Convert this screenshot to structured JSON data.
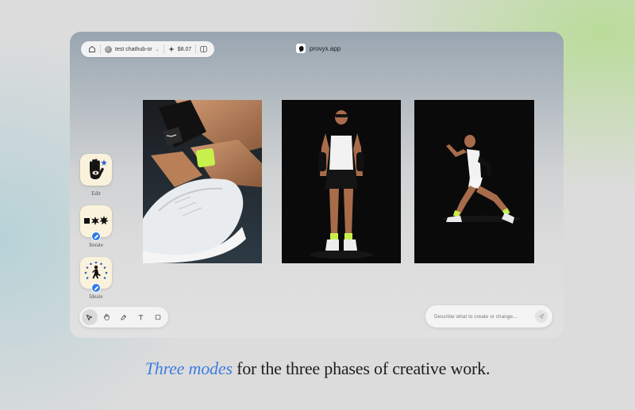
{
  "topbar": {
    "home_icon": "home-icon",
    "workspace": "test chathub-or",
    "credits": "$8.07",
    "credits_icon": "sparkle-icon",
    "panel_icon": "panel-icon"
  },
  "brand": {
    "name": "provyx.app",
    "logo_icon": "head-silhouette-icon"
  },
  "modes": [
    {
      "label": "Edit",
      "icon": "hand-eye-icon"
    },
    {
      "label": "Iterate",
      "icon": "shapes-icon"
    },
    {
      "label": "Ideate",
      "icon": "walking-person-stars-icon"
    }
  ],
  "tools": [
    {
      "name": "pointer",
      "icon": "cursor-icon",
      "active": true
    },
    {
      "name": "hand",
      "icon": "hand-icon",
      "active": false
    },
    {
      "name": "pen",
      "icon": "pen-icon",
      "active": false
    },
    {
      "name": "text",
      "icon": "text-icon",
      "active": false
    },
    {
      "name": "rectangle",
      "icon": "square-icon",
      "active": false
    }
  ],
  "prompt": {
    "placeholder": "Describe what to create or change...",
    "send_icon": "send-icon"
  },
  "tagline": {
    "accent": "Three modes",
    "rest": " for the three phases of creative work."
  },
  "colors": {
    "accent": "#3f7de0",
    "badge": "#2f7be5",
    "mode_bg": "#fbf2dc",
    "neon_sock": "#c8f04c"
  }
}
